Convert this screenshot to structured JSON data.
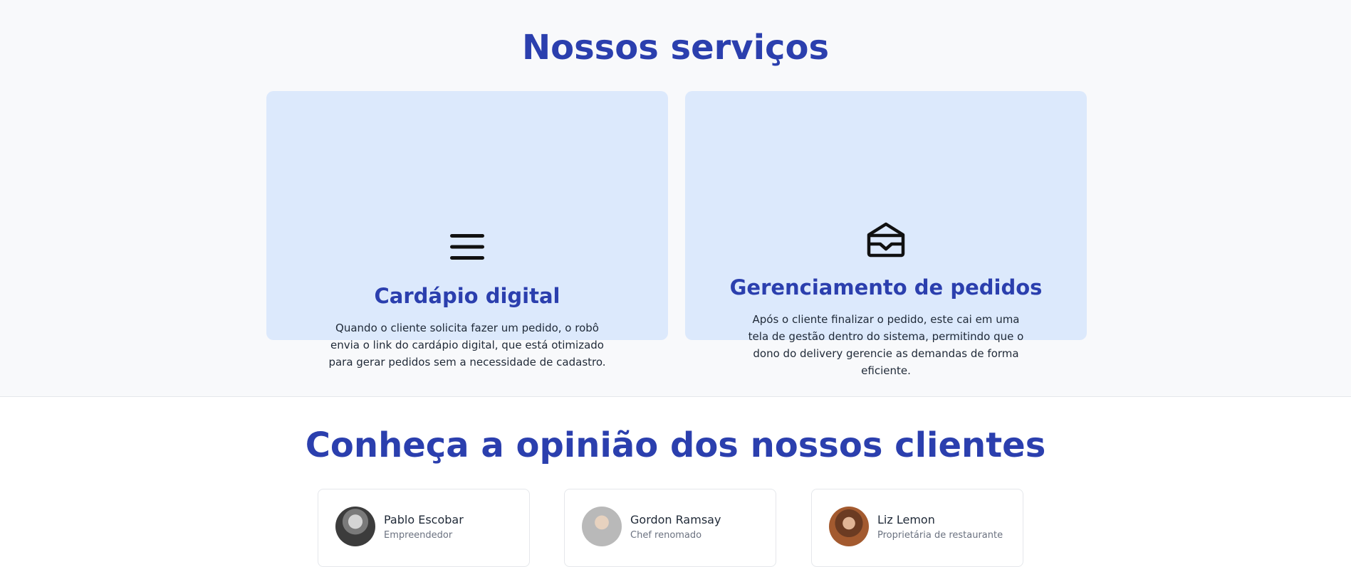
{
  "services": {
    "title": "Nossos serviços",
    "cards": [
      {
        "icon": "menu-icon",
        "title": "Cardápio digital",
        "text": "Quando o cliente solicita fazer um pedido, o robô envia o link do cardápio digital, que está otimizado para gerar pedidos sem a necessidade de cadastro."
      },
      {
        "icon": "inbox-tray-icon",
        "title": "Gerenciamento de pedidos",
        "text": "Após o cliente finalizar o pedido, este cai em uma tela de gestão dentro do sistema, permitindo que o dono do delivery gerencie as demandas de forma eficiente."
      }
    ]
  },
  "testimonials": {
    "title": "Conheça a opinião dos nossos clientes",
    "items": [
      {
        "name": "Pablo Escobar",
        "role": "Empreendedor"
      },
      {
        "name": "Gordon Ramsay",
        "role": "Chef renomado"
      },
      {
        "name": "Liz Lemon",
        "role": "Proprietária de restaurante"
      }
    ]
  },
  "colors": {
    "heading": "#2b3fae",
    "card_background": "#dce9fc",
    "section_background": "#f8f9fb"
  }
}
